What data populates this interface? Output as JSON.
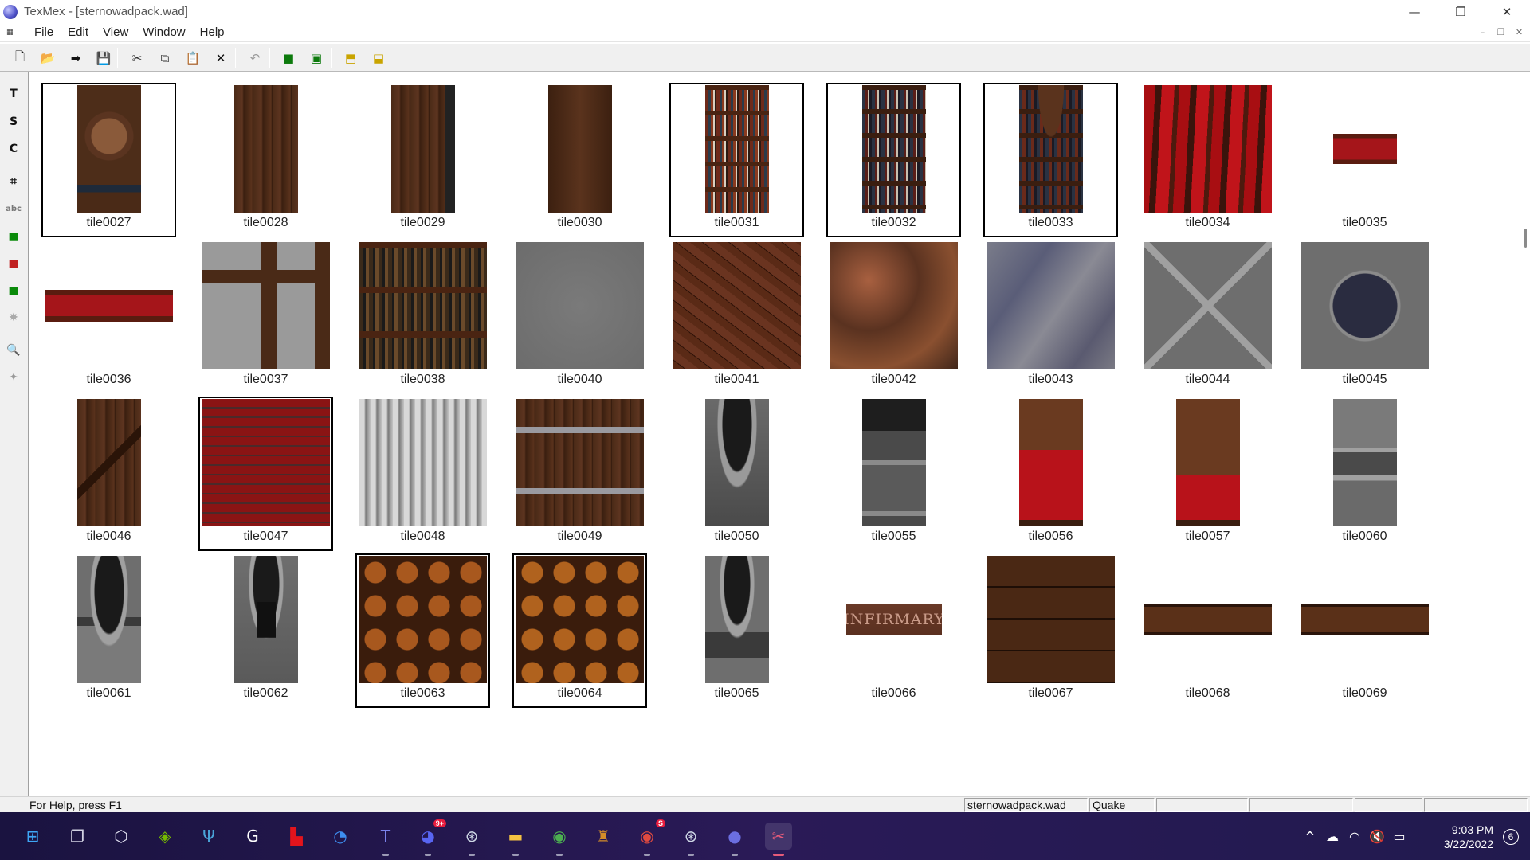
{
  "window": {
    "title": "TexMex - [sternowadpack.wad]",
    "controls": {
      "minimize": "—",
      "restore": "❐",
      "close": "✕"
    }
  },
  "menubar": {
    "items": [
      "File",
      "Edit",
      "View",
      "Window",
      "Help"
    ],
    "mdi_controls": {
      "minimize": "–",
      "restore": "❐",
      "close": "✕"
    }
  },
  "toolbar": {
    "buttons": [
      {
        "name": "new-file-icon",
        "glyph": "🗋"
      },
      {
        "name": "open-folder-icon",
        "glyph": "📂"
      },
      {
        "name": "import-arrow-icon",
        "glyph": "➡"
      },
      {
        "name": "save-disk-icon",
        "glyph": "💾"
      },
      {
        "name": "cut-icon",
        "glyph": "✂"
      },
      {
        "name": "copy-icon",
        "glyph": "⧉"
      },
      {
        "name": "paste-icon",
        "glyph": "📋"
      },
      {
        "name": "delete-x-icon",
        "glyph": "✕"
      },
      {
        "name": "undo-icon",
        "glyph": "↶"
      },
      {
        "name": "view-small-icon",
        "glyph": "■"
      },
      {
        "name": "view-fit-icon",
        "glyph": "▣"
      },
      {
        "name": "export-yellow-icon",
        "glyph": "⬒"
      },
      {
        "name": "import-yellow-icon",
        "glyph": "⬓"
      }
    ]
  },
  "tools": [
    {
      "name": "tool-t-icon",
      "glyph": "T"
    },
    {
      "name": "tool-s-icon",
      "glyph": "S"
    },
    {
      "name": "tool-c-icon",
      "glyph": "C"
    },
    {
      "name": "crop-icon",
      "glyph": "⌗"
    },
    {
      "name": "text-abc-icon",
      "glyph": "abc"
    },
    {
      "name": "green-layer-icon",
      "glyph": "■"
    },
    {
      "name": "green-red-icon",
      "glyph": "■"
    },
    {
      "name": "red-green-icon",
      "glyph": "■"
    },
    {
      "name": "sparkle-icon",
      "glyph": "✸"
    },
    {
      "name": "zoom-icon",
      "glyph": "🔍"
    },
    {
      "name": "figure-icon",
      "glyph": "✦"
    }
  ],
  "tiles": [
    {
      "label": "tile0027",
      "selected": true,
      "shape": "tall",
      "kind": "door-ornate"
    },
    {
      "label": "tile0028",
      "selected": false,
      "shape": "tall",
      "kind": "wood-planks"
    },
    {
      "label": "tile0029",
      "selected": false,
      "shape": "tall",
      "kind": "wood-planks-edge"
    },
    {
      "label": "tile0030",
      "selected": false,
      "shape": "tall",
      "kind": "door-plain"
    },
    {
      "label": "tile0031",
      "selected": true,
      "shape": "tall",
      "kind": "bookshelf"
    },
    {
      "label": "tile0032",
      "selected": true,
      "shape": "tall",
      "kind": "bookshelf-dark"
    },
    {
      "label": "tile0033",
      "selected": true,
      "shape": "tall",
      "kind": "bookshelf-arch"
    },
    {
      "label": "tile0034",
      "selected": false,
      "shape": "square",
      "kind": "red-wood"
    },
    {
      "label": "tile0035",
      "selected": false,
      "shape": "small",
      "kind": "red-panel"
    },
    {
      "label": "tile0036",
      "selected": false,
      "shape": "wide",
      "kind": "red-strip"
    },
    {
      "label": "tile0037",
      "selected": false,
      "shape": "square",
      "kind": "stone-cross"
    },
    {
      "label": "tile0038",
      "selected": false,
      "shape": "square",
      "kind": "bookshelf-wide"
    },
    {
      "label": "tile0040",
      "selected": false,
      "shape": "square",
      "kind": "gray-stone"
    },
    {
      "label": "tile0041",
      "selected": false,
      "shape": "square",
      "kind": "brown-cracked"
    },
    {
      "label": "tile0042",
      "selected": false,
      "shape": "square",
      "kind": "brown-marble"
    },
    {
      "label": "tile0043",
      "selected": false,
      "shape": "square",
      "kind": "blue-marble"
    },
    {
      "label": "tile0044",
      "selected": false,
      "shape": "square",
      "kind": "gray-diamond"
    },
    {
      "label": "tile0045",
      "selected": false,
      "shape": "square",
      "kind": "gray-circle"
    },
    {
      "label": "tile0046",
      "selected": false,
      "shape": "tall",
      "kind": "door-z"
    },
    {
      "label": "tile0047",
      "selected": true,
      "shape": "square",
      "kind": "red-brick"
    },
    {
      "label": "tile0048",
      "selected": false,
      "shape": "square",
      "kind": "corrugated"
    },
    {
      "label": "tile0049",
      "selected": false,
      "shape": "square",
      "kind": "wood-bars"
    },
    {
      "label": "tile0050",
      "selected": false,
      "shape": "tall",
      "kind": "stone-arch"
    },
    {
      "label": "tile0055",
      "selected": false,
      "shape": "tall",
      "kind": "stone-column"
    },
    {
      "label": "tile0056",
      "selected": false,
      "shape": "tall",
      "kind": "red-door"
    },
    {
      "label": "tile0057",
      "selected": false,
      "shape": "tall",
      "kind": "red-door-2"
    },
    {
      "label": "tile0060",
      "selected": false,
      "shape": "tall",
      "kind": "stone-band"
    },
    {
      "label": "tile0061",
      "selected": false,
      "shape": "tall",
      "kind": "stone-window"
    },
    {
      "label": "tile0062",
      "selected": false,
      "shape": "tall",
      "kind": "stone-window-bars"
    },
    {
      "label": "tile0063",
      "selected": true,
      "shape": "square",
      "kind": "barrels"
    },
    {
      "label": "tile0064",
      "selected": true,
      "shape": "square",
      "kind": "barrels-2"
    },
    {
      "label": "tile0065",
      "selected": false,
      "shape": "tall",
      "kind": "stone-window-drip"
    },
    {
      "label": "tile0066",
      "selected": false,
      "shape": "sign",
      "kind": "sign",
      "sign_text": "INFIRMARY"
    },
    {
      "label": "tile0067",
      "selected": false,
      "shape": "square",
      "kind": "wood-floor"
    },
    {
      "label": "tile0068",
      "selected": false,
      "shape": "wide",
      "kind": "wood-strip"
    },
    {
      "label": "tile0069",
      "selected": false,
      "shape": "wide",
      "kind": "wood-strip"
    }
  ],
  "statusbar": {
    "help": "For Help, press F1",
    "file": "sternowadpack.wad",
    "game": "Quake"
  },
  "taskbar": {
    "apps": [
      {
        "name": "windows-start-icon",
        "glyph": "⊞",
        "color": "#3ea6f5",
        "pinned": false
      },
      {
        "name": "task-view-icon",
        "glyph": "❐",
        "color": "#d0d0e0",
        "pinned": false
      },
      {
        "name": "3d-cube-icon",
        "glyph": "⬡",
        "color": "#e0e0f0",
        "pinned": false
      },
      {
        "name": "nvidia-icon",
        "glyph": "◈",
        "color": "#76b900",
        "pinned": false
      },
      {
        "name": "predator-icon",
        "glyph": "Ψ",
        "color": "#4aa3d8",
        "pinned": false
      },
      {
        "name": "logitech-g-icon",
        "glyph": "G",
        "color": "#ffffff",
        "pinned": false
      },
      {
        "name": "red-app-icon",
        "glyph": "▙",
        "color": "#e3141c",
        "pinned": false
      },
      {
        "name": "blue-circle-icon",
        "glyph": "◔",
        "color": "#3d8ef0",
        "pinned": false
      },
      {
        "name": "teams-icon",
        "glyph": "T",
        "color": "#7b83eb",
        "pinned": true
      },
      {
        "name": "discord-icon",
        "glyph": "◕",
        "color": "#5865f2",
        "pinned": true,
        "badge": "9+"
      },
      {
        "name": "steam-icon",
        "glyph": "⊛",
        "color": "#cfd8e6",
        "pinned": true
      },
      {
        "name": "file-explorer-icon",
        "glyph": "▬",
        "color": "#f5c242",
        "pinned": true
      },
      {
        "name": "chrome-icon",
        "glyph": "◉",
        "color": "#4caf50",
        "pinned": true
      },
      {
        "name": "lantern-app-icon",
        "glyph": "♜",
        "color": "#d48c28",
        "pinned": false
      },
      {
        "name": "chrome-profile-icon",
        "glyph": "◉",
        "color": "#e04a3f",
        "pinned": true,
        "badge": "S"
      },
      {
        "name": "steam-2-icon",
        "glyph": "⊛",
        "color": "#cfd8e6",
        "pinned": true
      },
      {
        "name": "texmex-taskbar-icon",
        "glyph": "●",
        "color": "#6b6ee0",
        "pinned": true
      },
      {
        "name": "snipping-tool-icon",
        "glyph": "✂",
        "color": "#e65b7a",
        "pinned": true
      }
    ],
    "tray_icons": [
      "chevron-up-icon",
      "cloud-icon",
      "wifi-icon",
      "speaker-muted-icon",
      "battery-icon"
    ],
    "tray_glyphs": [
      "^",
      "☁",
      "◠",
      "🔇",
      "▭"
    ],
    "time": "9:03 PM",
    "date": "3/22/2022",
    "notifications": "6"
  }
}
